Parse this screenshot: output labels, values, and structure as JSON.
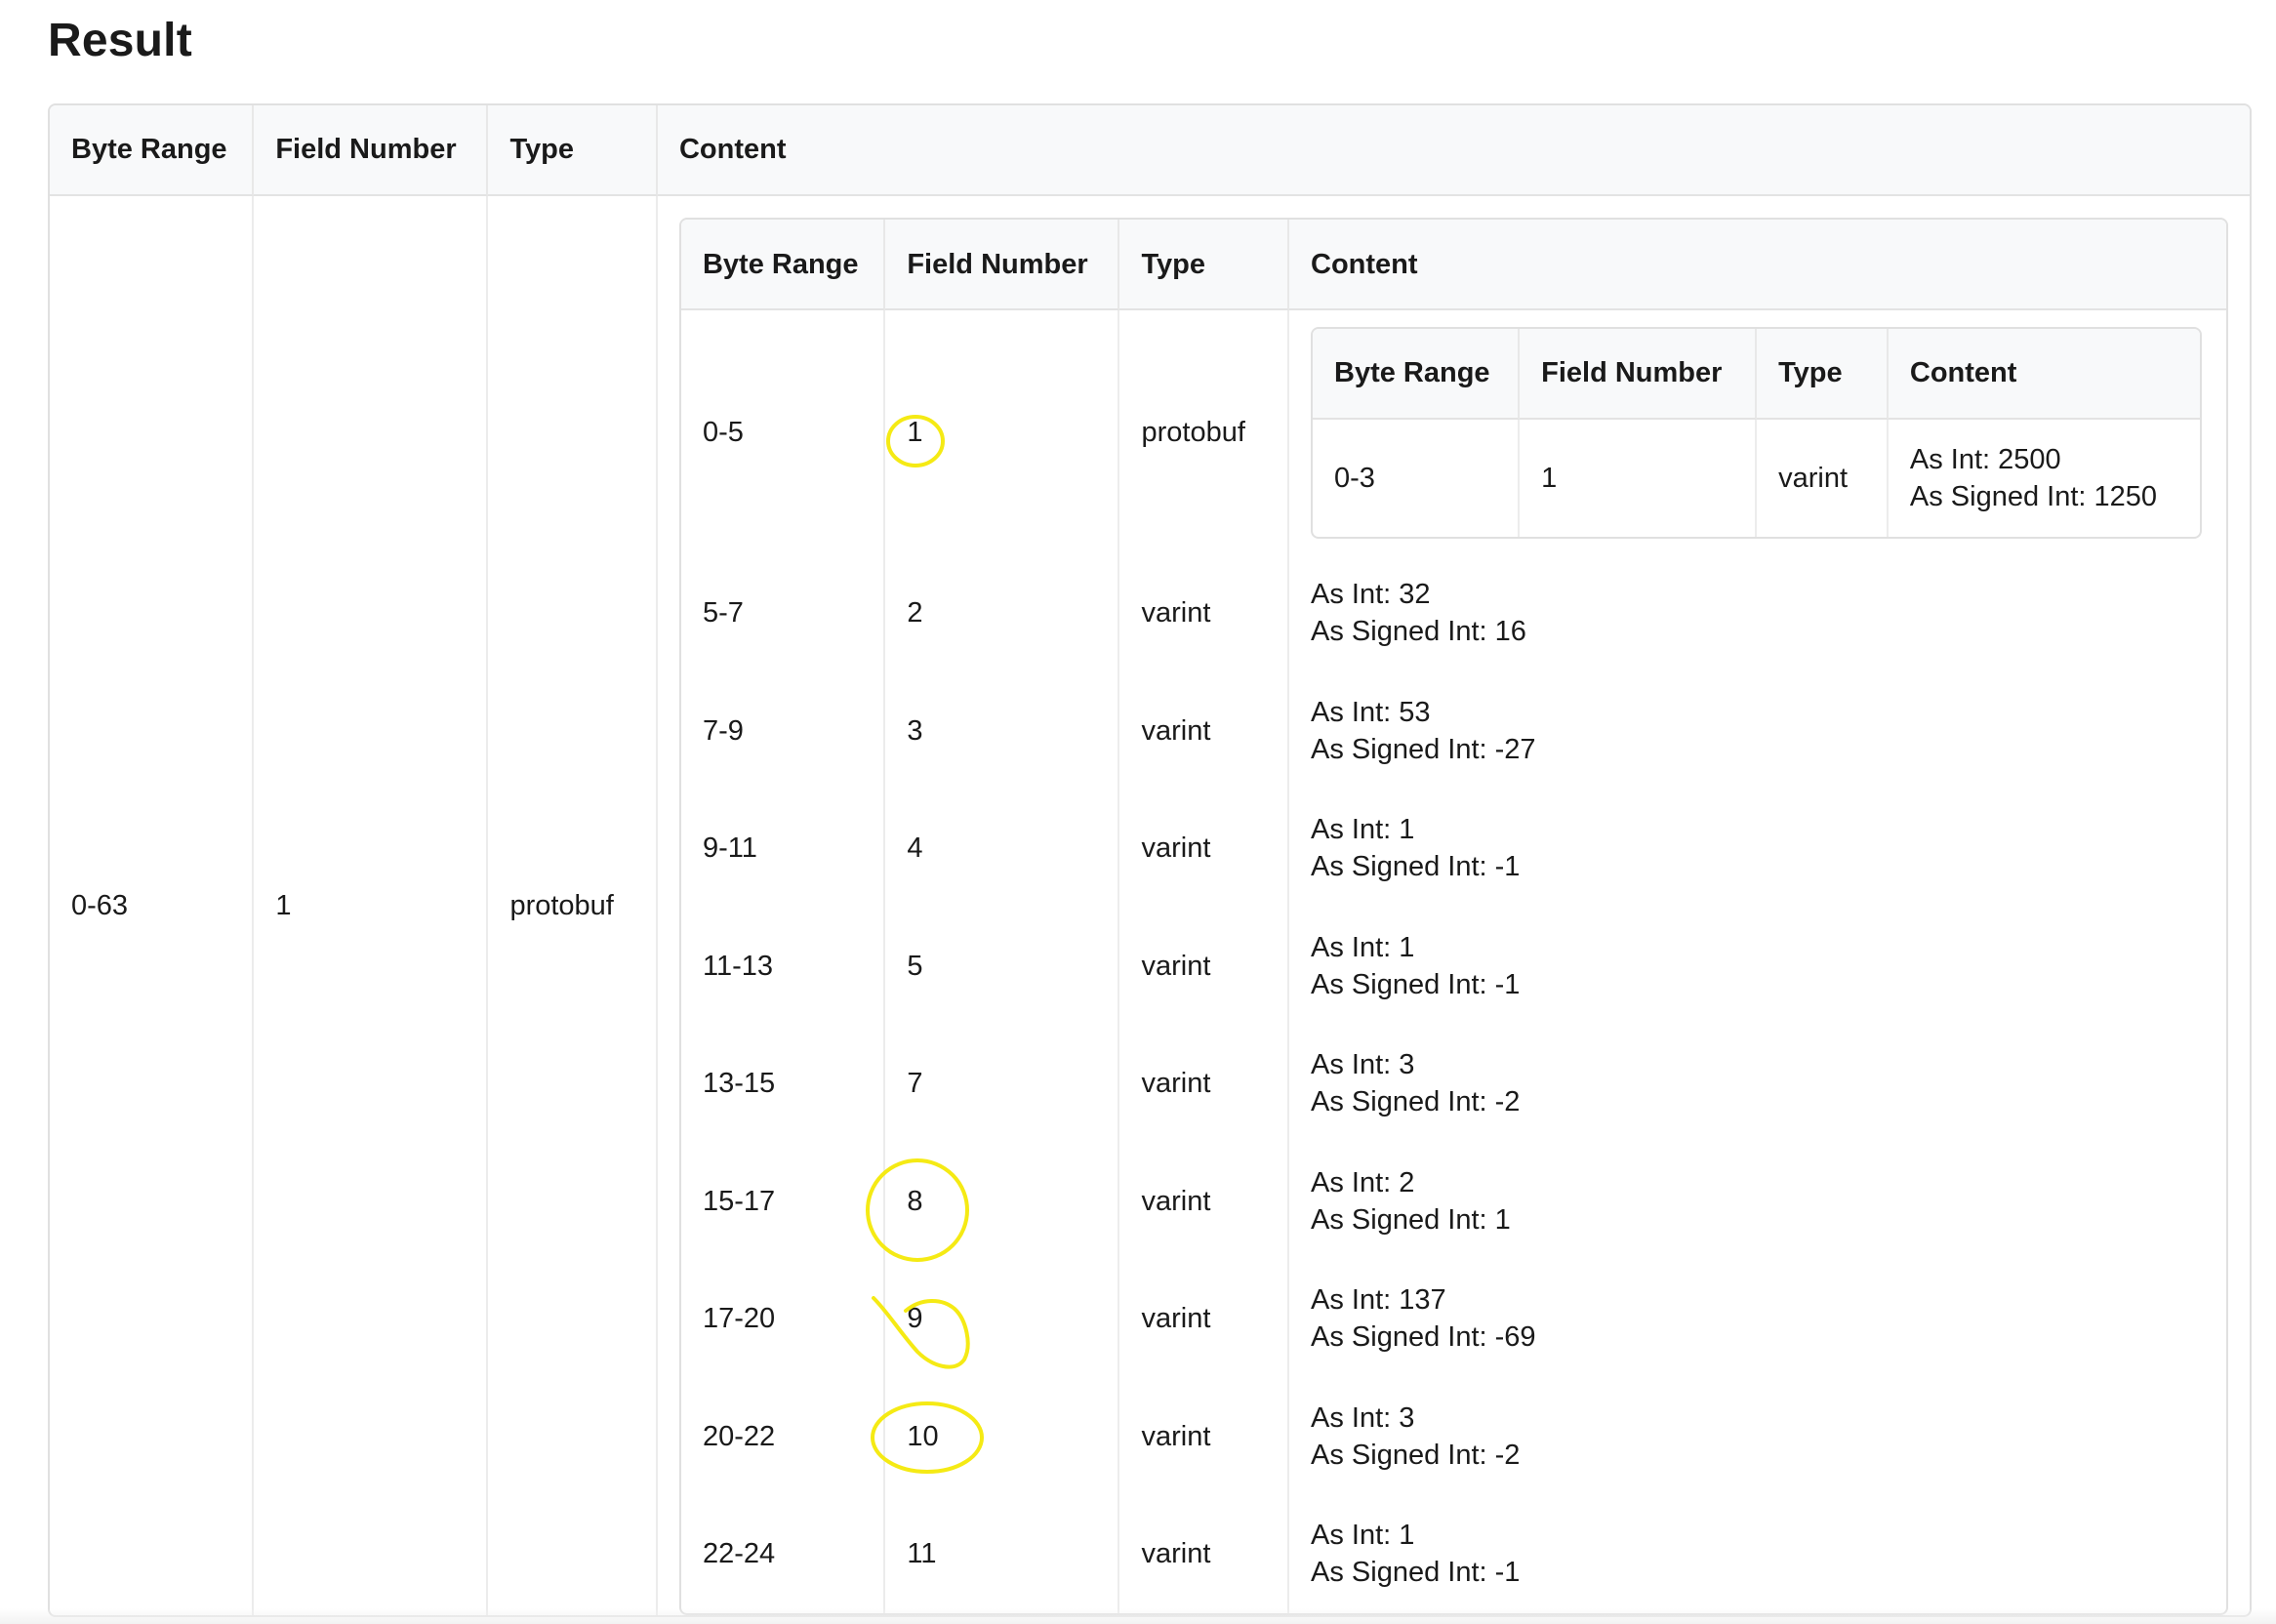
{
  "page": {
    "title": "Result"
  },
  "outer": {
    "headers": [
      "Byte Range",
      "Field Number",
      "Type",
      "Content"
    ],
    "row": {
      "byte_range": "0-63",
      "field_number": "1",
      "type": "protobuf"
    }
  },
  "mid": {
    "headers": [
      "Byte Range",
      "Field Number",
      "Type",
      "Content"
    ],
    "first_row": {
      "byte_range": "0-5",
      "field_number": "1",
      "type": "protobuf"
    },
    "rows": [
      {
        "byte_range": "5-7",
        "field_number": "2",
        "type": "varint",
        "as_int": "As Int: 32",
        "as_signed": "As Signed Int: 16"
      },
      {
        "byte_range": "7-9",
        "field_number": "3",
        "type": "varint",
        "as_int": "As Int: 53",
        "as_signed": "As Signed Int: -27"
      },
      {
        "byte_range": "9-11",
        "field_number": "4",
        "type": "varint",
        "as_int": "As Int: 1",
        "as_signed": "As Signed Int: -1"
      },
      {
        "byte_range": "11-13",
        "field_number": "5",
        "type": "varint",
        "as_int": "As Int: 1",
        "as_signed": "As Signed Int: -1"
      },
      {
        "byte_range": "13-15",
        "field_number": "7",
        "type": "varint",
        "as_int": "As Int: 3",
        "as_signed": "As Signed Int: -2"
      },
      {
        "byte_range": "15-17",
        "field_number": "8",
        "type": "varint",
        "as_int": "As Int: 2",
        "as_signed": "As Signed Int: 1"
      },
      {
        "byte_range": "17-20",
        "field_number": "9",
        "type": "varint",
        "as_int": "As Int: 137",
        "as_signed": "As Signed Int: -69"
      },
      {
        "byte_range": "20-22",
        "field_number": "10",
        "type": "varint",
        "as_int": "As Int: 3",
        "as_signed": "As Signed Int: -2"
      },
      {
        "byte_range": "22-24",
        "field_number": "11",
        "type": "varint",
        "as_int": "As Int: 1",
        "as_signed": "As Signed Int: -1"
      }
    ]
  },
  "inner": {
    "headers": [
      "Byte Range",
      "Field Number",
      "Type",
      "Content"
    ],
    "row": {
      "byte_range": "0-3",
      "field_number": "1",
      "type": "varint",
      "as_int": "As Int: 2500",
      "as_signed": "As Signed Int: 1250"
    }
  },
  "annotations": {
    "color": "#f5ea14",
    "circled_field_numbers": [
      "1",
      "8",
      "9",
      "10"
    ]
  }
}
